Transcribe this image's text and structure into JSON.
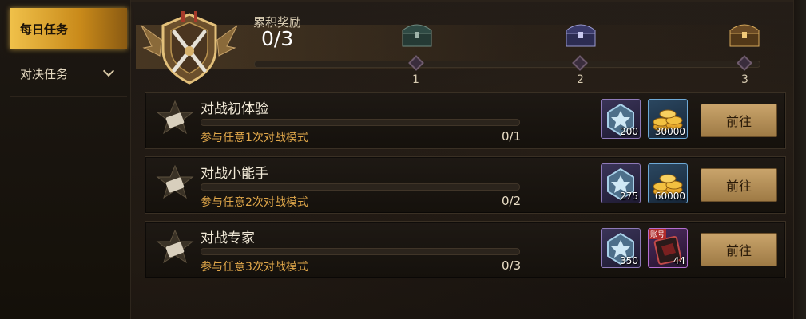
{
  "sidebar": {
    "items": [
      {
        "label": "每日任务",
        "active": true
      },
      {
        "label": "对决任务",
        "active": false
      }
    ]
  },
  "reward": {
    "title": "累积奖励",
    "count": "0/3",
    "progress_fraction": 0,
    "milestones": [
      "1",
      "2",
      "3"
    ]
  },
  "tasks": [
    {
      "name": "对战初体验",
      "desc": "参与任意1次对战模式",
      "progress": "0/1",
      "rewards": [
        {
          "icon": "crystal-icon",
          "qty": "200"
        },
        {
          "icon": "gold-coins-icon",
          "qty": "30000"
        }
      ],
      "button": "前往"
    },
    {
      "name": "对战小能手",
      "desc": "参与任意2次对战模式",
      "progress": "0/2",
      "rewards": [
        {
          "icon": "crystal-icon",
          "qty": "275"
        },
        {
          "icon": "gold-coins-icon",
          "qty": "60000"
        }
      ],
      "button": "前往"
    },
    {
      "name": "对战专家",
      "desc": "参与任意3次对战模式",
      "progress": "0/3",
      "rewards": [
        {
          "icon": "crystal-icon",
          "qty": "350"
        },
        {
          "icon": "card-pack-icon",
          "qty": "44",
          "tag": "账号"
        }
      ],
      "button": "前往"
    }
  ],
  "colors": {
    "accent_gold": "#f0c14a",
    "desc_orange": "#e0a74a",
    "button": "#c9a46b"
  }
}
